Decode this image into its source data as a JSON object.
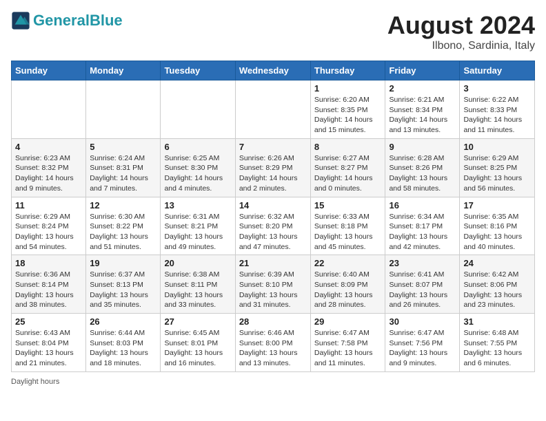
{
  "header": {
    "logo_general": "General",
    "logo_blue": "Blue",
    "month_title": "August 2024",
    "location": "Ilbono, Sardinia, Italy"
  },
  "days_of_week": [
    "Sunday",
    "Monday",
    "Tuesday",
    "Wednesday",
    "Thursday",
    "Friday",
    "Saturday"
  ],
  "weeks": [
    [
      {
        "day": "",
        "info": ""
      },
      {
        "day": "",
        "info": ""
      },
      {
        "day": "",
        "info": ""
      },
      {
        "day": "",
        "info": ""
      },
      {
        "day": "1",
        "info": "Sunrise: 6:20 AM\nSunset: 8:35 PM\nDaylight: 14 hours and 15 minutes."
      },
      {
        "day": "2",
        "info": "Sunrise: 6:21 AM\nSunset: 8:34 PM\nDaylight: 14 hours and 13 minutes."
      },
      {
        "day": "3",
        "info": "Sunrise: 6:22 AM\nSunset: 8:33 PM\nDaylight: 14 hours and 11 minutes."
      }
    ],
    [
      {
        "day": "4",
        "info": "Sunrise: 6:23 AM\nSunset: 8:32 PM\nDaylight: 14 hours and 9 minutes."
      },
      {
        "day": "5",
        "info": "Sunrise: 6:24 AM\nSunset: 8:31 PM\nDaylight: 14 hours and 7 minutes."
      },
      {
        "day": "6",
        "info": "Sunrise: 6:25 AM\nSunset: 8:30 PM\nDaylight: 14 hours and 4 minutes."
      },
      {
        "day": "7",
        "info": "Sunrise: 6:26 AM\nSunset: 8:29 PM\nDaylight: 14 hours and 2 minutes."
      },
      {
        "day": "8",
        "info": "Sunrise: 6:27 AM\nSunset: 8:27 PM\nDaylight: 14 hours and 0 minutes."
      },
      {
        "day": "9",
        "info": "Sunrise: 6:28 AM\nSunset: 8:26 PM\nDaylight: 13 hours and 58 minutes."
      },
      {
        "day": "10",
        "info": "Sunrise: 6:29 AM\nSunset: 8:25 PM\nDaylight: 13 hours and 56 minutes."
      }
    ],
    [
      {
        "day": "11",
        "info": "Sunrise: 6:29 AM\nSunset: 8:24 PM\nDaylight: 13 hours and 54 minutes."
      },
      {
        "day": "12",
        "info": "Sunrise: 6:30 AM\nSunset: 8:22 PM\nDaylight: 13 hours and 51 minutes."
      },
      {
        "day": "13",
        "info": "Sunrise: 6:31 AM\nSunset: 8:21 PM\nDaylight: 13 hours and 49 minutes."
      },
      {
        "day": "14",
        "info": "Sunrise: 6:32 AM\nSunset: 8:20 PM\nDaylight: 13 hours and 47 minutes."
      },
      {
        "day": "15",
        "info": "Sunrise: 6:33 AM\nSunset: 8:18 PM\nDaylight: 13 hours and 45 minutes."
      },
      {
        "day": "16",
        "info": "Sunrise: 6:34 AM\nSunset: 8:17 PM\nDaylight: 13 hours and 42 minutes."
      },
      {
        "day": "17",
        "info": "Sunrise: 6:35 AM\nSunset: 8:16 PM\nDaylight: 13 hours and 40 minutes."
      }
    ],
    [
      {
        "day": "18",
        "info": "Sunrise: 6:36 AM\nSunset: 8:14 PM\nDaylight: 13 hours and 38 minutes."
      },
      {
        "day": "19",
        "info": "Sunrise: 6:37 AM\nSunset: 8:13 PM\nDaylight: 13 hours and 35 minutes."
      },
      {
        "day": "20",
        "info": "Sunrise: 6:38 AM\nSunset: 8:11 PM\nDaylight: 13 hours and 33 minutes."
      },
      {
        "day": "21",
        "info": "Sunrise: 6:39 AM\nSunset: 8:10 PM\nDaylight: 13 hours and 31 minutes."
      },
      {
        "day": "22",
        "info": "Sunrise: 6:40 AM\nSunset: 8:09 PM\nDaylight: 13 hours and 28 minutes."
      },
      {
        "day": "23",
        "info": "Sunrise: 6:41 AM\nSunset: 8:07 PM\nDaylight: 13 hours and 26 minutes."
      },
      {
        "day": "24",
        "info": "Sunrise: 6:42 AM\nSunset: 8:06 PM\nDaylight: 13 hours and 23 minutes."
      }
    ],
    [
      {
        "day": "25",
        "info": "Sunrise: 6:43 AM\nSunset: 8:04 PM\nDaylight: 13 hours and 21 minutes."
      },
      {
        "day": "26",
        "info": "Sunrise: 6:44 AM\nSunset: 8:03 PM\nDaylight: 13 hours and 18 minutes."
      },
      {
        "day": "27",
        "info": "Sunrise: 6:45 AM\nSunset: 8:01 PM\nDaylight: 13 hours and 16 minutes."
      },
      {
        "day": "28",
        "info": "Sunrise: 6:46 AM\nSunset: 8:00 PM\nDaylight: 13 hours and 13 minutes."
      },
      {
        "day": "29",
        "info": "Sunrise: 6:47 AM\nSunset: 7:58 PM\nDaylight: 13 hours and 11 minutes."
      },
      {
        "day": "30",
        "info": "Sunrise: 6:47 AM\nSunset: 7:56 PM\nDaylight: 13 hours and 9 minutes."
      },
      {
        "day": "31",
        "info": "Sunrise: 6:48 AM\nSunset: 7:55 PM\nDaylight: 13 hours and 6 minutes."
      }
    ]
  ],
  "footer": {
    "note": "Daylight hours"
  }
}
